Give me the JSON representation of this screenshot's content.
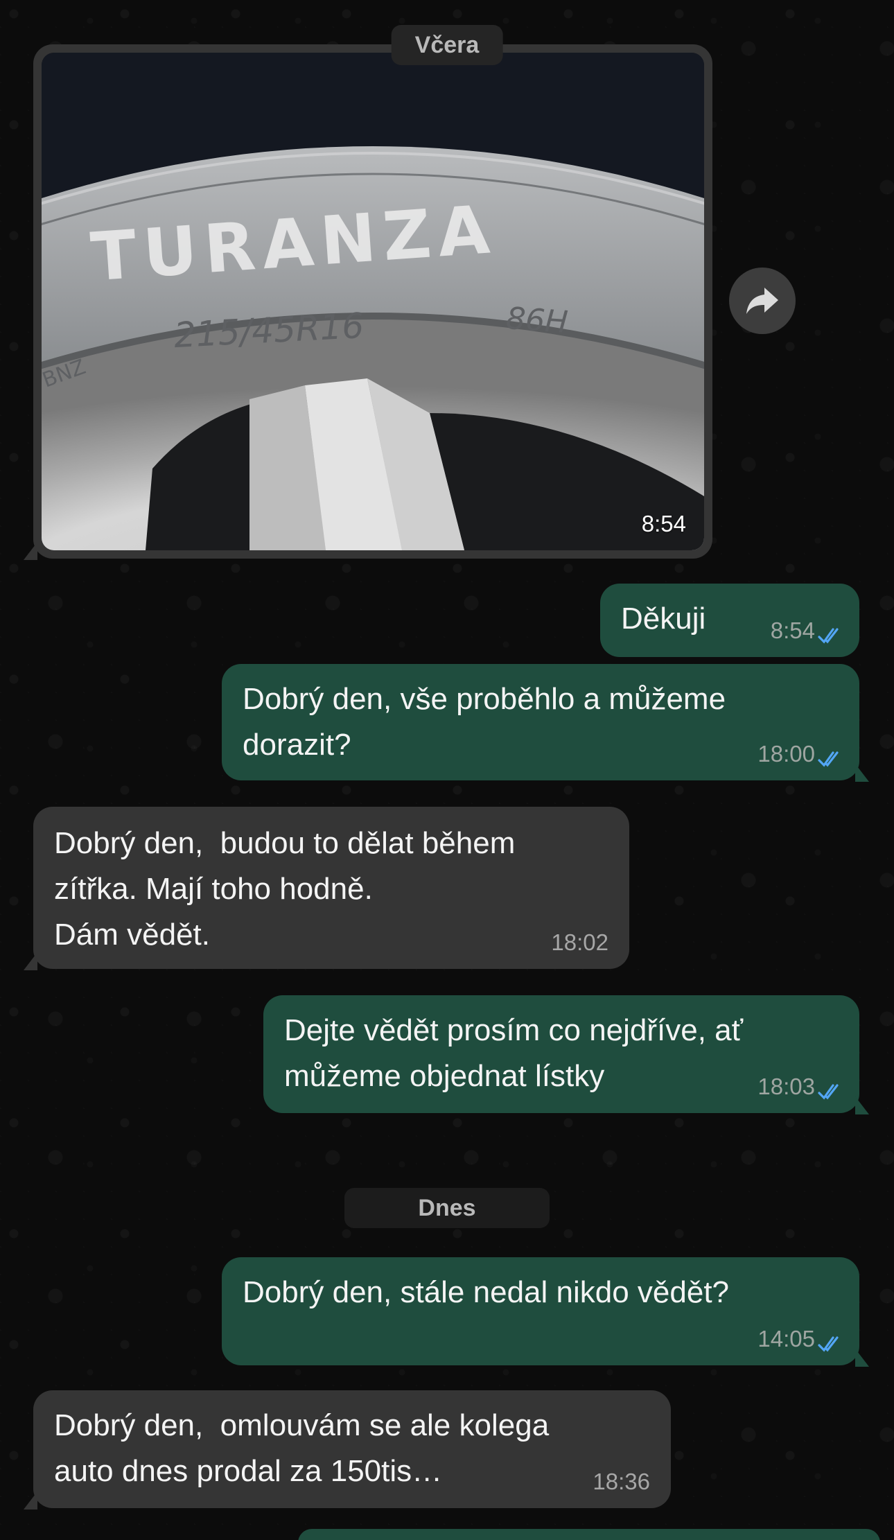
{
  "dates": {
    "yesterday": "Včera",
    "today": "Dnes"
  },
  "photo_message": {
    "time": "8:54",
    "tire_brand": "TURANZA",
    "tire_size": "215/45R16",
    "load_speed": "86H",
    "side_text": "BNZ"
  },
  "messages": [
    {
      "direction": "out",
      "text": "Děkuji",
      "time": "8:54",
      "status": "read"
    },
    {
      "direction": "out",
      "text": "Dobrý den, vše proběhlo a můžeme dorazit?",
      "time": "18:00",
      "status": "read"
    },
    {
      "direction": "in",
      "text": "Dobrý den,  budou to dělat během zítřka. Mají toho hodně.\nDám vědět.",
      "time": "18:02"
    },
    {
      "direction": "out",
      "text": "Dejte vědět prosím co nejdříve, ať můžeme objednat lístky",
      "time": "18:03",
      "status": "read"
    },
    {
      "direction": "out",
      "text": "Dobrý den, stále nedal nikdo vědět?",
      "time": "14:05",
      "status": "read"
    },
    {
      "direction": "in",
      "text": "Dobrý den,  omlouvám se ale kolega auto dnes prodal za 150tis…",
      "time": "18:36"
    }
  ],
  "colors": {
    "incoming_bubble": "#353535",
    "outgoing_bubble": "#1f4d3e",
    "read_ticks": "#53a6f5",
    "background": "#0c0c0c"
  },
  "icons": {
    "forward": "forward-arrow-icon",
    "read": "double-check-icon"
  }
}
